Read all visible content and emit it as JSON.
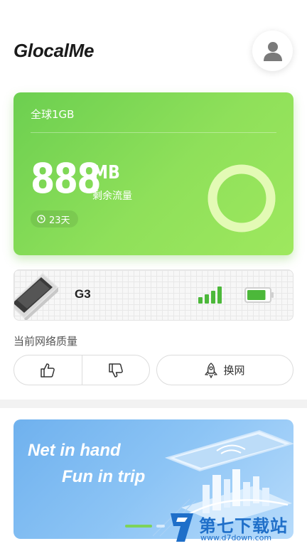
{
  "header": {
    "brand": "GlocalMe",
    "avatar_icon": "user-icon"
  },
  "data_card": {
    "plan_name": "全球1GB",
    "remaining_value": "888",
    "remaining_unit": "MB",
    "remaining_label": "剩余流量",
    "days_left": "23天",
    "clock_icon": "clock-icon",
    "usage_ring_remaining_fraction": 1.0,
    "colors": {
      "card_start": "#6ccf50",
      "card_end": "#9ee85e",
      "ring": "#e3fab5"
    }
  },
  "device": {
    "name": "G3",
    "signal_bars": 4,
    "battery_level": 0.85,
    "colors": {
      "signal": "#4cb83a",
      "battery": "#4cb83a"
    }
  },
  "network_quality": {
    "label": "当前网络质量",
    "like_icon": "thumbs-up-icon",
    "dislike_icon": "thumbs-down-icon",
    "switch_label": "换网",
    "switch_icon": "rocket-icon"
  },
  "banner": {
    "line1": "Net in hand",
    "line2": "Fun in trip",
    "active_slide": 1,
    "slide_count": 2
  },
  "watermark": {
    "text": "第七下载站",
    "url": "www.d7down.com"
  }
}
